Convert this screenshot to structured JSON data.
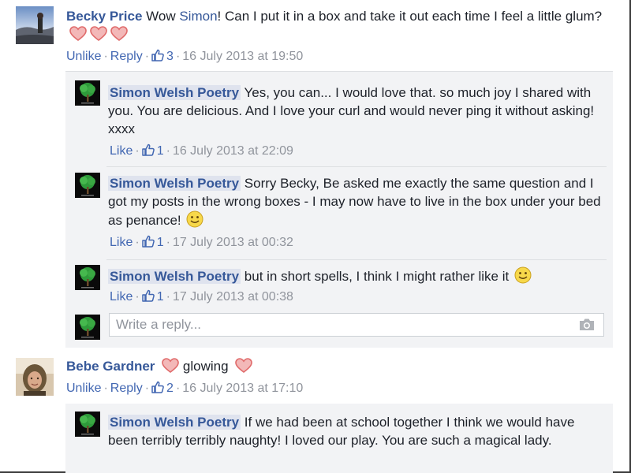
{
  "comments": [
    {
      "author": "Becky Price",
      "text_before": "Wow ",
      "mention": "Simon",
      "text_after": "! Can I put it in a box and take it out each time I feel a little glum?",
      "actions": {
        "unlike": "Unlike",
        "reply": "Reply",
        "likes": "3",
        "time": "16 July 2013 at 19:50"
      },
      "replies": [
        {
          "author": "Simon Welsh Poetry",
          "text": "Yes, you can... I would love that. so much joy I shared with you. You are delicious. And I love your curl and would never ping it without asking! xxxx",
          "actions": {
            "like": "Like",
            "likes": "1",
            "time": "16 July 2013 at 22:09"
          }
        },
        {
          "author": "Simon Welsh Poetry",
          "text": "Sorry Becky, Be asked me exactly the same question and I got my posts in the wrong boxes - I may now have to live in the box under your bed as penance!",
          "actions": {
            "like": "Like",
            "likes": "1",
            "time": "17 July 2013 at 00:32"
          }
        },
        {
          "author": "Simon Welsh Poetry",
          "text": "but in short spells, I think I might rather like it",
          "actions": {
            "like": "Like",
            "likes": "1",
            "time": "17 July 2013 at 00:38"
          }
        }
      ],
      "reply_box": {
        "placeholder": "Write a reply..."
      }
    },
    {
      "author": "Bebe Gardner",
      "text": "glowing",
      "actions": {
        "unlike": "Unlike",
        "reply": "Reply",
        "likes": "2",
        "time": "16 July 2013 at 17:10"
      },
      "replies": [
        {
          "author": "Simon Welsh Poetry",
          "text": "If we had been at school together I think we would have been terribly terribly naughty! I loved our play. You are such a magical lady."
        }
      ]
    }
  ],
  "colors": {
    "link": "#365899",
    "meta": "#90949c",
    "heart": "#e06b6b",
    "panel": "#f2f3f5",
    "chip": "#dfe3ee"
  },
  "icons": {
    "heart": "heart-icon",
    "thumb": "thumbs-up-icon",
    "smiley": "smiley-icon",
    "camera": "camera-icon"
  }
}
